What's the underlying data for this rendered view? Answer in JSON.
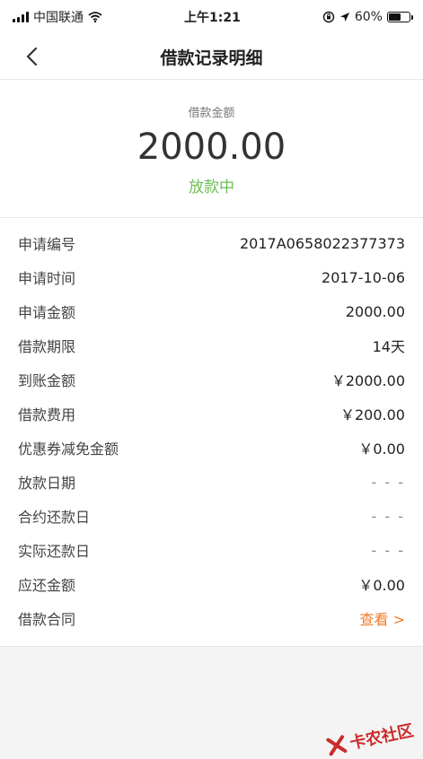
{
  "status_bar": {
    "carrier": "中国联通",
    "time": "上午1:21",
    "battery": "60%",
    "battery_level": 0.6
  },
  "nav": {
    "title": "借款记录明细"
  },
  "summary": {
    "label": "借款金额",
    "amount": "2000.00",
    "status": "放款中"
  },
  "details": [
    {
      "label": "申请编号",
      "value": "2017A0658022377373"
    },
    {
      "label": "申请时间",
      "value": "2017-10-06"
    },
    {
      "label": "申请金额",
      "value": "2000.00"
    },
    {
      "label": "借款期限",
      "value": "14天"
    },
    {
      "label": "到账金额",
      "value": "￥2000.00"
    },
    {
      "label": "借款费用",
      "value": "￥200.00"
    },
    {
      "label": "优惠券减免金额",
      "value": "￥0.00"
    },
    {
      "label": "放款日期",
      "value": "- - -"
    },
    {
      "label": "合约还款日",
      "value": "- - -"
    },
    {
      "label": "实际还款日",
      "value": "- - -"
    },
    {
      "label": "应还金额",
      "value": "￥0.00"
    },
    {
      "label": "借款合同",
      "value": "查看 >"
    }
  ],
  "watermark": {
    "text": "卡农社区"
  },
  "colors": {
    "status_green": "#6cbf52",
    "link_orange": "#ee7b2b"
  }
}
